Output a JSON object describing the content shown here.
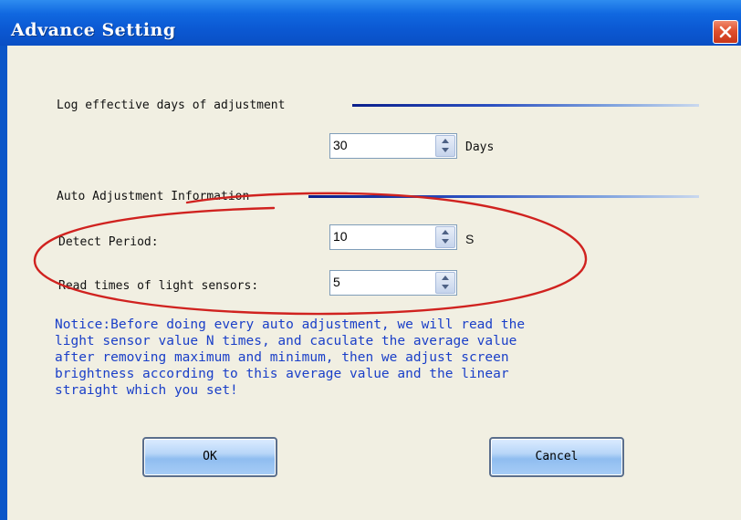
{
  "window": {
    "title": "Advance Setting"
  },
  "log_group": {
    "label": "Log effective days of adjustment",
    "days_value": "30",
    "days_unit": "Days"
  },
  "auto_group": {
    "label": "Auto Adjustment Information",
    "detect_period_label": "Detect Period:",
    "detect_period_value": "10",
    "detect_period_unit": "S",
    "read_times_label": "Read times of light sensors:",
    "read_times_value": "5"
  },
  "notice": {
    "text": "Notice:Before doing every auto adjustment, we will read the\nlight sensor value N times,  and caculate the average value\nafter removing maximum and minimum, then we adjust screen\nbrightness according to this average value and the linear\nstraight which you set!"
  },
  "buttons": {
    "ok_label": "OK",
    "cancel_label": "Cancel"
  },
  "colors": {
    "titlebar": "#0b58d2",
    "client_bg": "#f1efe2",
    "notice_text": "#1a3fc8",
    "annotation_ellipse": "#d0221f",
    "close_button": "#e0502e"
  },
  "icons": {
    "close": "close-x-icon",
    "spin": "spin-up-down-icon"
  }
}
